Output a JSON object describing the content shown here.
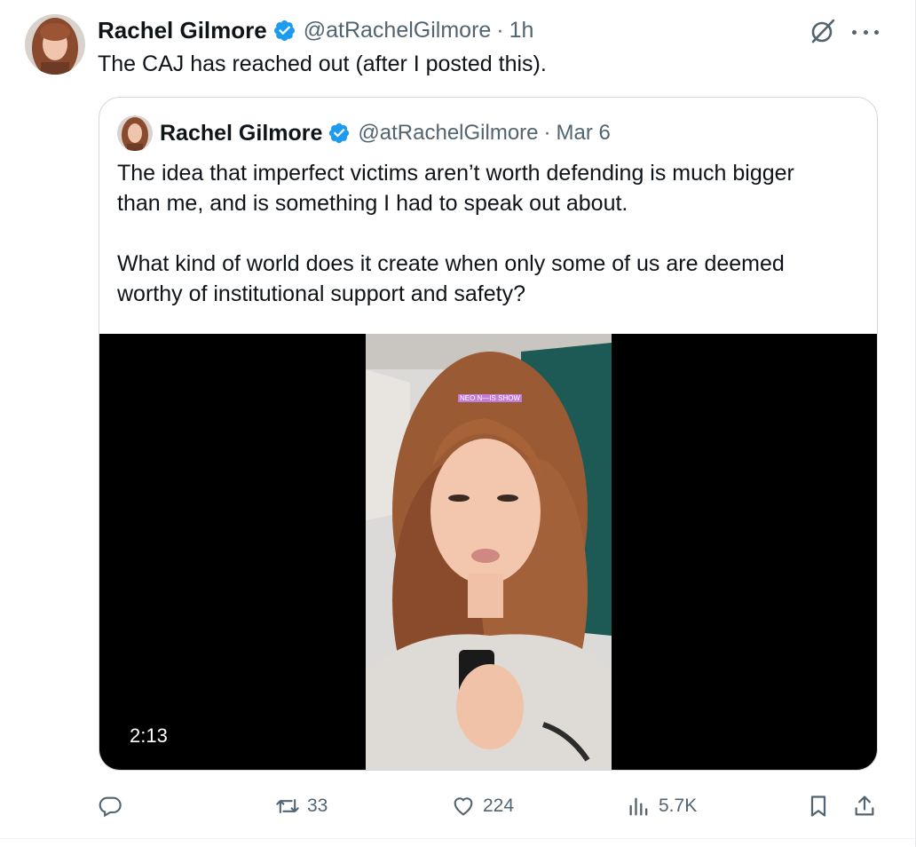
{
  "tweet": {
    "author_name": "Rachel Gilmore",
    "handle": "@atRachelGilmore",
    "separator": "·",
    "time": "1h",
    "text": "The CAJ has reached out (after I posted this)."
  },
  "quoted_tweet": {
    "author_name": "Rachel Gilmore",
    "handle": "@atRachelGilmore",
    "separator": "·",
    "date": "Mar 6",
    "paragraphs": [
      "The idea that imperfect victims aren’t worth defending is much bigger",
      "than me, and is something I had to speak out about.",
      "What kind of world does it create when only some of us are deemed",
      "worthy of institutional support and safety?"
    ],
    "video": {
      "duration": "2:13",
      "overlay_caption": "NEO N—IS SHOW"
    }
  },
  "actions": {
    "reply_count": "",
    "retweet_count": "33",
    "like_count": "224",
    "views_count": "5.7K"
  },
  "icons": {
    "verified": "verified-badge-icon",
    "grok": "grok-icon",
    "more": "more-icon",
    "reply": "reply-icon",
    "retweet": "retweet-icon",
    "like": "heart-icon",
    "views": "views-icon",
    "bookmark": "bookmark-icon",
    "share": "share-icon"
  },
  "colors": {
    "verified": "#1d9bf0",
    "secondary_text": "#536471",
    "primary_text": "#0f1419",
    "border": "#cfd9de"
  }
}
